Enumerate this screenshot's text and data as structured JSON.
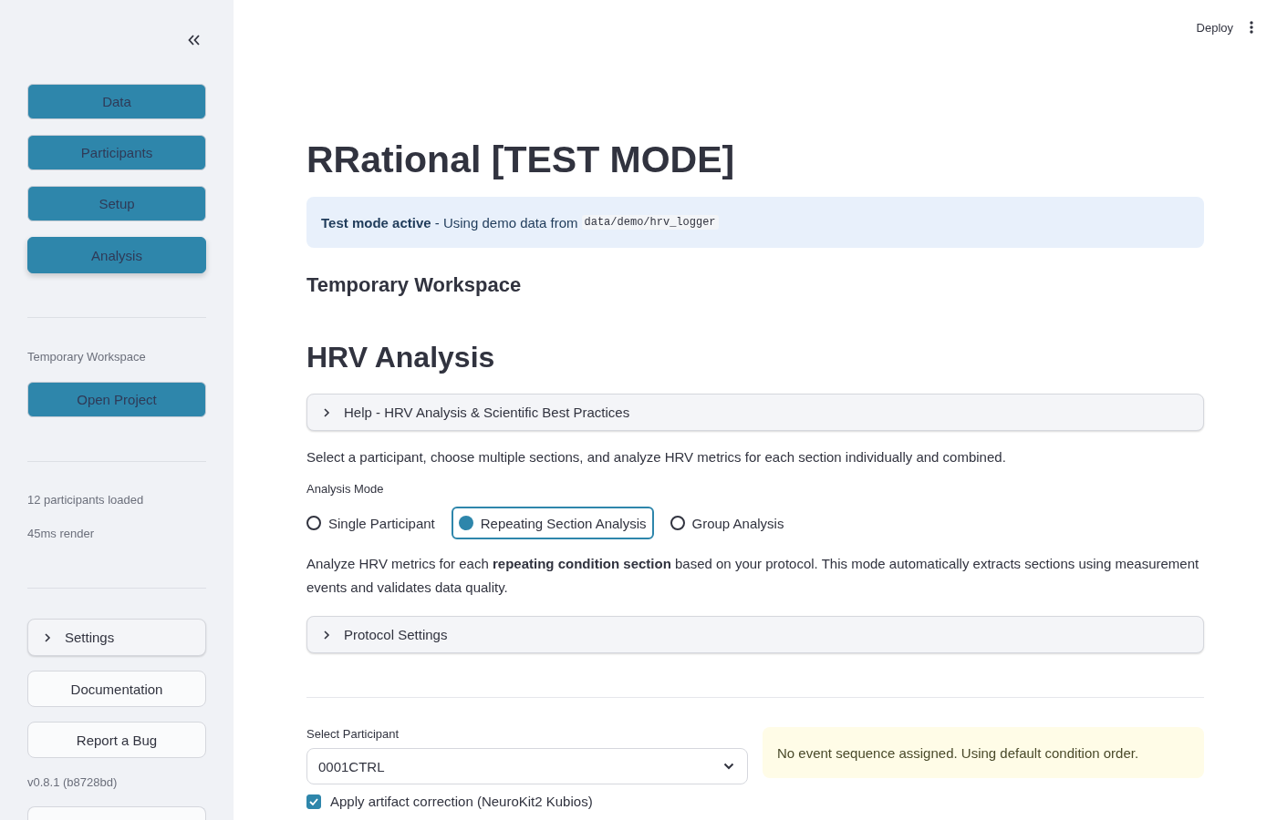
{
  "sidebar": {
    "nav_buttons": [
      {
        "label": "Data",
        "selected": false
      },
      {
        "label": "Participants",
        "selected": false
      },
      {
        "label": "Setup",
        "selected": false
      },
      {
        "label": "Analysis",
        "selected": true
      }
    ],
    "workspace_label": "Temporary Workspace",
    "open_project_button": "Open Project",
    "stats": [
      "12 participants loaded",
      "45ms render"
    ],
    "settings_expander": {
      "label": "Settings",
      "expanded": false
    },
    "link_buttons": [
      "Documentation",
      "Report a Bug"
    ],
    "version": "v0.8.1 (b8728bd)"
  },
  "header": {
    "deploy_button": "Deploy"
  },
  "main": {
    "title": "RRational [TEST MODE]",
    "info_alert": {
      "text": "**Test mode active** - Using demo data from",
      "code": "data/demo/hrv_logger"
    },
    "workspace_heading": "Temporary Workspace",
    "section_heading": "HRV Analysis",
    "help_expander": {
      "label": "Help - HRV Analysis & Scientific Best Practices",
      "expanded": false
    },
    "description": "Select a participant, choose multiple sections, and analyze HRV metrics for each section individually and combined.",
    "analysis_mode": {
      "label": "Analysis Mode",
      "options": [
        {
          "label": "Single Participant",
          "selected": false
        },
        {
          "label": "Repeating Section Analysis",
          "selected": true
        },
        {
          "label": "Group Analysis",
          "selected": false
        }
      ]
    },
    "mode_description": "Analyze HRV metrics for each **repeating condition section** based on your protocol. This mode automatically extracts sections using measurement events and validates data quality.",
    "protocol_expander": {
      "label": "Protocol Settings",
      "expanded": false
    },
    "participant_select": {
      "label": "Select Participant",
      "value": "0001CTRL"
    },
    "warning": "No event sequence assigned. Using default condition order.",
    "artifact_checkbox": {
      "label": "Apply artifact correction (NeuroKit2 Kubios)",
      "checked": true
    }
  }
}
